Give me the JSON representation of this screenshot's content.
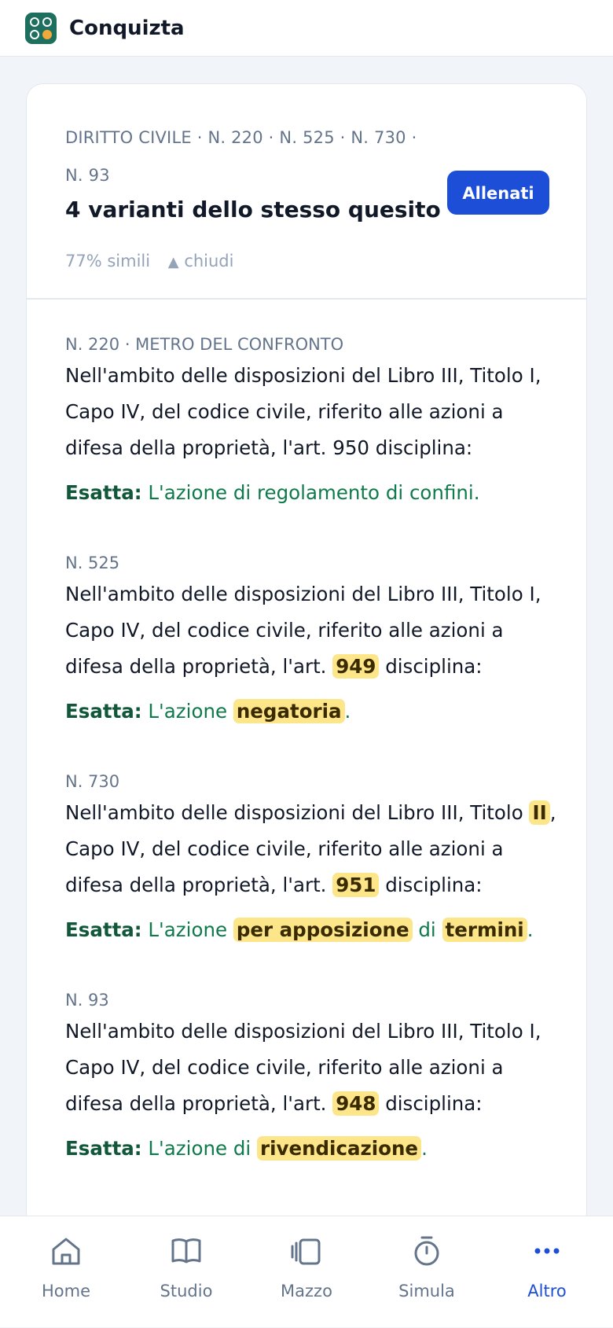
{
  "app": {
    "title": "Conquizta"
  },
  "card": {
    "kicker": "DIRITTO CIVILE · N. 220 · N. 525 · N. 730 · N. 93",
    "title": "4 varianti dello stesso quesito",
    "similarity": "77% simili",
    "toggle_label": "chiudi",
    "train_button": "Allenati"
  },
  "variants": [
    {
      "label": "N. 220 · METRO DEL CONFRONTO",
      "question": [
        "Nell'ambito delle disposizioni del Libro III, Titolo I, Capo IV, del codice civile, riferito alle azioni a difesa della proprietà, l'art. 950 disciplina:"
      ],
      "answer_lead": "Esatta:",
      "answer": [
        "L'azione di regolamento di confini."
      ]
    },
    {
      "label": "N. 525",
      "question": [
        "Nell'ambito delle disposizioni del Libro III, Titolo I, Capo IV, del codice civile, riferito alle azioni a difesa della proprietà, l'art. ",
        {
          "hl": "949"
        },
        " disciplina:"
      ],
      "answer_lead": "Esatta:",
      "answer": [
        "L'azione ",
        {
          "hl": "negatoria"
        },
        "."
      ]
    },
    {
      "label": "N. 730",
      "question": [
        "Nell'ambito delle disposizioni del Libro III, Titolo ",
        {
          "hl": "II"
        },
        ", Capo IV, del codice civile, riferito alle azioni a difesa della proprietà, l'art. ",
        {
          "hl": "951"
        },
        " disciplina:"
      ],
      "answer_lead": "Esatta:",
      "answer": [
        "L'azione ",
        {
          "hl": "per apposizione"
        },
        " di ",
        {
          "hl": "termini"
        },
        "."
      ]
    },
    {
      "label": "N. 93",
      "question": [
        "Nell'ambito delle disposizioni del Libro III, Titolo I, Capo IV, del codice civile, riferito alle azioni a difesa della proprietà, l'art. ",
        {
          "hl": "948"
        },
        " disciplina:"
      ],
      "answer_lead": "Esatta:",
      "answer": [
        "L'azione di ",
        {
          "hl": "rivendicazione"
        },
        "."
      ]
    }
  ],
  "nav": {
    "items": [
      {
        "label": "Home",
        "icon": "home-icon"
      },
      {
        "label": "Studio",
        "icon": "book-icon"
      },
      {
        "label": "Mazzo",
        "icon": "cards-icon"
      },
      {
        "label": "Simula",
        "icon": "stopwatch-icon"
      },
      {
        "label": "Altro",
        "icon": "more-icon",
        "active": true
      }
    ]
  },
  "colors": {
    "accent": "#1d4ed8",
    "correct": "#0f7a4b",
    "highlight": "#fde58a",
    "brand": "#1f6f5f"
  }
}
